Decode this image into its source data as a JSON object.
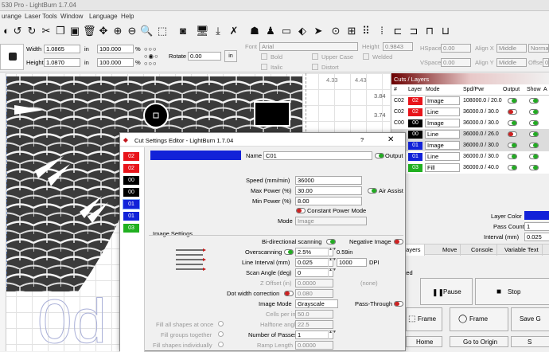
{
  "window": {
    "title": "530 Pro - LightBurn 1.7.04"
  },
  "menu": [
    "urange",
    "Laser Tools",
    "Window",
    "Language",
    "Help"
  ],
  "numeric": {
    "width_label": "Width",
    "width": "1.0865",
    "height_label": "Height",
    "height": "1.0870",
    "unit": "in",
    "scale_w": "100.000",
    "scale_h": "100.000",
    "pct": "%",
    "rotate_label": "Rotate",
    "rotate": "0.00",
    "in_btn": "in"
  },
  "font": {
    "font_label": "Font",
    "font": "Arial",
    "height_label": "Height",
    "height": "0.9843",
    "bold": "Bold",
    "italic": "Italic",
    "upper": "Upper Case",
    "welded": "Welded",
    "distort": "Distort",
    "hspace_label": "HSpace",
    "hspace": "0.00",
    "vspace_label": "VSpace",
    "vspace": "0.00",
    "alignx_label": "Align X",
    "alignx": "Middle",
    "aligny_label": "Align Y",
    "aligny": "Middle",
    "normal": "Norma",
    "offset_label": "Offset",
    "offset": "0"
  },
  "ruler": {
    "v1": "3.84",
    "v2": "3.74",
    "h1": "4.33",
    "h2": "4.43"
  },
  "canvas": {
    "text": "0d"
  },
  "cuts": {
    "title": "Cuts / Layers",
    "headers": [
      "#",
      "Layer",
      "Mode",
      "Spd/Pwr",
      "Output",
      "Show",
      "A"
    ],
    "rows": [
      {
        "num": "C02",
        "layer": "02",
        "color": "#e8141a",
        "mode": "Image",
        "spd": "108000.0 / 20.0"
      },
      {
        "num": "C02",
        "layer": "02",
        "color": "#e8141a",
        "mode": "Line",
        "spd": "36000.0 / 30.0"
      },
      {
        "num": "C00",
        "layer": "00",
        "color": "#000000",
        "mode": "Image",
        "spd": "36000.0 / 30.0"
      },
      {
        "num": "",
        "layer": "00",
        "color": "#000000",
        "mode": "Line",
        "spd": "36000.0 / 26.0"
      },
      {
        "num": "",
        "layer": "01",
        "color": "#1222d8",
        "mode": "Image",
        "spd": "36000.0 / 30.0"
      },
      {
        "num": "",
        "layer": "01",
        "color": "#1222d8",
        "mode": "Line",
        "spd": "36000.0 / 30.0"
      },
      {
        "num": "",
        "layer": "03",
        "color": "#20b020",
        "mode": "Fill",
        "spd": "36000.0 / 40.0"
      }
    ],
    "layer_color": "Layer Color",
    "pass_count_label": "Pass Count",
    "pass_count": "1",
    "interval_label": "Interval (mm)",
    "interval": "0.025"
  },
  "tabs": [
    "s / Layers",
    "Move",
    "Console",
    "Variable Text"
  ],
  "laser": {
    "connected": "nnected",
    "pause": "Pause",
    "stop": "Stop",
    "frame1": "Frame",
    "frame2": "Frame",
    "save": "Save G",
    "home": "Home",
    "goto": "Go to Origin",
    "s": "S"
  },
  "dialog": {
    "title": "Cut Settings Editor - LightBurn 1.7.04",
    "help": "?",
    "name_label": "Name",
    "name": "C01",
    "output": "Output",
    "sidebar": [
      {
        "t": "02",
        "c": "#e8141a"
      },
      {
        "t": "02",
        "c": "#e8141a"
      },
      {
        "t": "00",
        "c": "#000000"
      },
      {
        "t": "00",
        "c": "#000000"
      },
      {
        "t": "01",
        "c": "#1222d8"
      },
      {
        "t": "01",
        "c": "#1222d8"
      },
      {
        "t": "03",
        "c": "#20b020"
      }
    ],
    "speed_label": "Speed (mm/min)",
    "speed": "36000",
    "maxp_label": "Max Power (%)",
    "maxp": "30.00",
    "air": "Air Assist",
    "minp_label": "Min Power (%)",
    "minp": "8.00",
    "cpm": "Constant Power Mode",
    "mode_label": "Mode",
    "mode": "Image",
    "image_settings": "Image Settings",
    "bidir": "Bi-directional scanning",
    "neg": "Negative Image",
    "overscan_label": "Overscanning",
    "overscan": "2.5%",
    "overscan_in": "0.59in",
    "interval_label": "Line Interval (mm)",
    "interval": "0.025",
    "dpi": "1000",
    "dpi_label": "DPI",
    "scan_label": "Scan Angle (deg)",
    "scan": "0",
    "zoff_label": "Z Offset (in)",
    "zoff": "0.0000",
    "none": "(none)",
    "dot_label": "Dot width correction",
    "dot": "0.080",
    "imgmode_label": "Image Mode",
    "imgmode": "Grayscale",
    "passthrough": "Pass-Through",
    "cells_label": "Cells per inch",
    "cells": "50.0",
    "fill_all": "Fill all shapes at once",
    "halftone_label": "Halftone angle",
    "halftone": "22.5",
    "fill_groups": "Fill groups together",
    "passes_label": "Number of Passes",
    "passes": "1",
    "fill_indiv": "Fill shapes individually",
    "ramp_label": "Ramp Length",
    "ramp": "0.0000"
  }
}
